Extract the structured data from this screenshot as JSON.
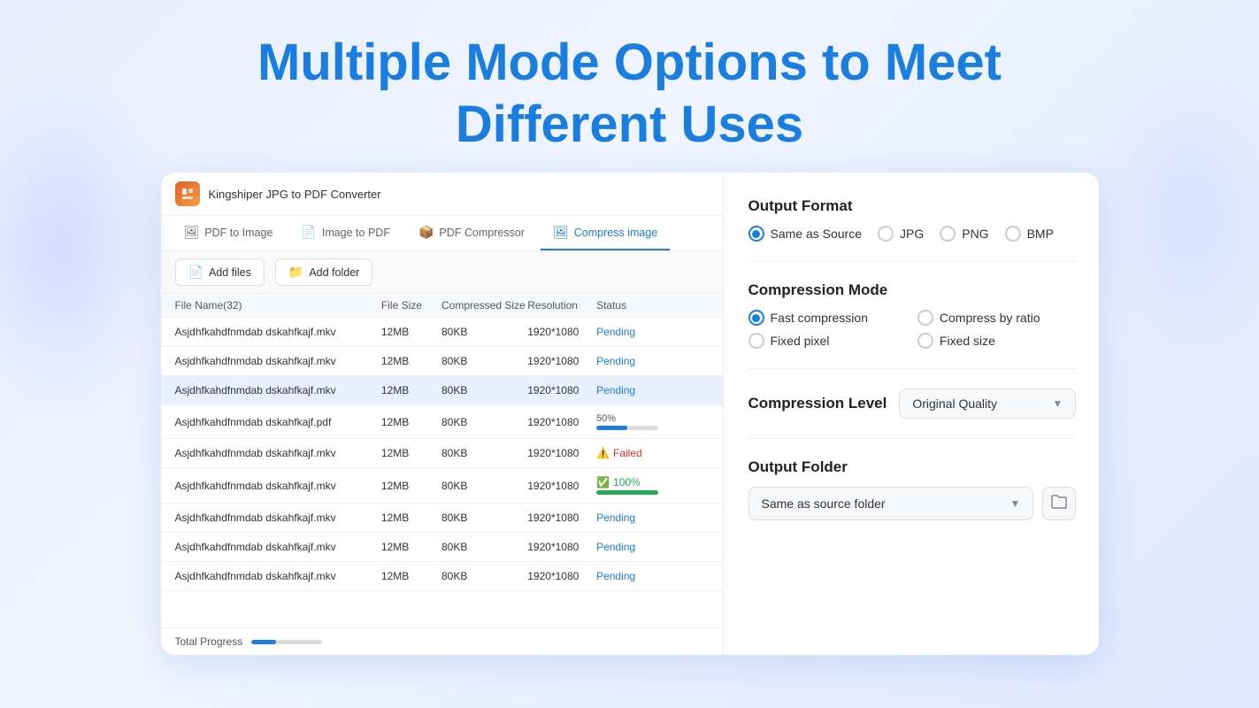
{
  "page": {
    "headline_line1": "Multiple Mode Options to Meet",
    "headline_line2": "Different Uses"
  },
  "app": {
    "title": "Kingshiper JPG to PDF Converter",
    "icon_label": "K",
    "nav_tabs": [
      {
        "id": "pdf-to-image",
        "label": "PDF to Image",
        "active": false
      },
      {
        "id": "image-to-pdf",
        "label": "Image to PDF",
        "active": false
      },
      {
        "id": "pdf-compressor",
        "label": "PDF Compressor",
        "active": false
      },
      {
        "id": "compress-image",
        "label": "Compress image",
        "active": true
      }
    ],
    "toolbar": {
      "add_files": "Add files",
      "add_folder": "Add folder"
    },
    "table": {
      "headers": [
        "File Name(32)",
        "File Size",
        "Compressed Size",
        "Resolution",
        "Status",
        ""
      ],
      "rows": [
        {
          "name": "Asjdhfkahdfnmdab dskahfkajf.mkv",
          "size": "12MB",
          "compressed": "80KB",
          "res": "1920*1080",
          "status": "pending",
          "status_text": "Pending",
          "highlighted": false
        },
        {
          "name": "Asjdhfkahdfnmdab dskahfkajf.mkv",
          "size": "12MB",
          "compressed": "80KB",
          "res": "1920*1080",
          "status": "pending",
          "status_text": "Pending",
          "highlighted": false
        },
        {
          "name": "Asjdhfkahdfnmdab dskahfkajf.mkv",
          "size": "12MB",
          "compressed": "80KB",
          "res": "1920*1080",
          "status": "pending",
          "status_text": "Pending",
          "highlighted": true
        },
        {
          "name": "Asjdhfkahdfnmdab dskahfkajf.pdf",
          "size": "12MB",
          "compressed": "80KB",
          "res": "1920*1080",
          "status": "progress50",
          "status_text": "50%",
          "highlighted": false
        },
        {
          "name": "Asjdhfkahdfnmdab dskahfkajf.mkv",
          "size": "12MB",
          "compressed": "80KB",
          "res": "1920*1080",
          "status": "failed",
          "status_text": "Failed",
          "highlighted": false
        },
        {
          "name": "Asjdhfkahdfnmdab dskahfkajf.mkv",
          "size": "12MB",
          "compressed": "80KB",
          "res": "1920*1080",
          "status": "success",
          "status_text": "100%",
          "highlighted": false
        },
        {
          "name": "Asjdhfkahdfnmdab dskahfkajf.mkv",
          "size": "12MB",
          "compressed": "80KB",
          "res": "1920*1080",
          "status": "pending",
          "status_text": "Pending",
          "highlighted": false
        },
        {
          "name": "Asjdhfkahdfnmdab dskahfkajf.mkv",
          "size": "12MB",
          "compressed": "80KB",
          "res": "1920*1080",
          "status": "pending",
          "status_text": "Pending",
          "highlighted": false
        },
        {
          "name": "Asjdhfkahdfnmdab dskahfkajf.mkv",
          "size": "12MB",
          "compressed": "80KB",
          "res": "1920*1080",
          "status": "pending",
          "status_text": "Pending",
          "highlighted": false
        }
      ]
    },
    "total_progress_label": "Total Progress"
  },
  "settings": {
    "output_format": {
      "title": "Output Format",
      "options": [
        {
          "id": "same-as-source",
          "label": "Same as Source",
          "checked": true
        },
        {
          "id": "jpg",
          "label": "JPG",
          "checked": false
        },
        {
          "id": "png",
          "label": "PNG",
          "checked": false
        },
        {
          "id": "bmp",
          "label": "BMP",
          "checked": false
        }
      ]
    },
    "compression_mode": {
      "title": "Compression Mode",
      "options": [
        {
          "id": "fast-compression",
          "label": "Fast compression",
          "checked": true
        },
        {
          "id": "compress-by-ratio",
          "label": "Compress by ratio",
          "checked": false
        },
        {
          "id": "fixed-pixel",
          "label": "Fixed pixel",
          "checked": false
        },
        {
          "id": "fixed-size",
          "label": "Fixed size",
          "checked": false
        }
      ]
    },
    "compression_level": {
      "title": "Compression Level",
      "value": "Original Quality"
    },
    "output_folder": {
      "title": "Output Folder",
      "value": "Same as source folder"
    }
  }
}
